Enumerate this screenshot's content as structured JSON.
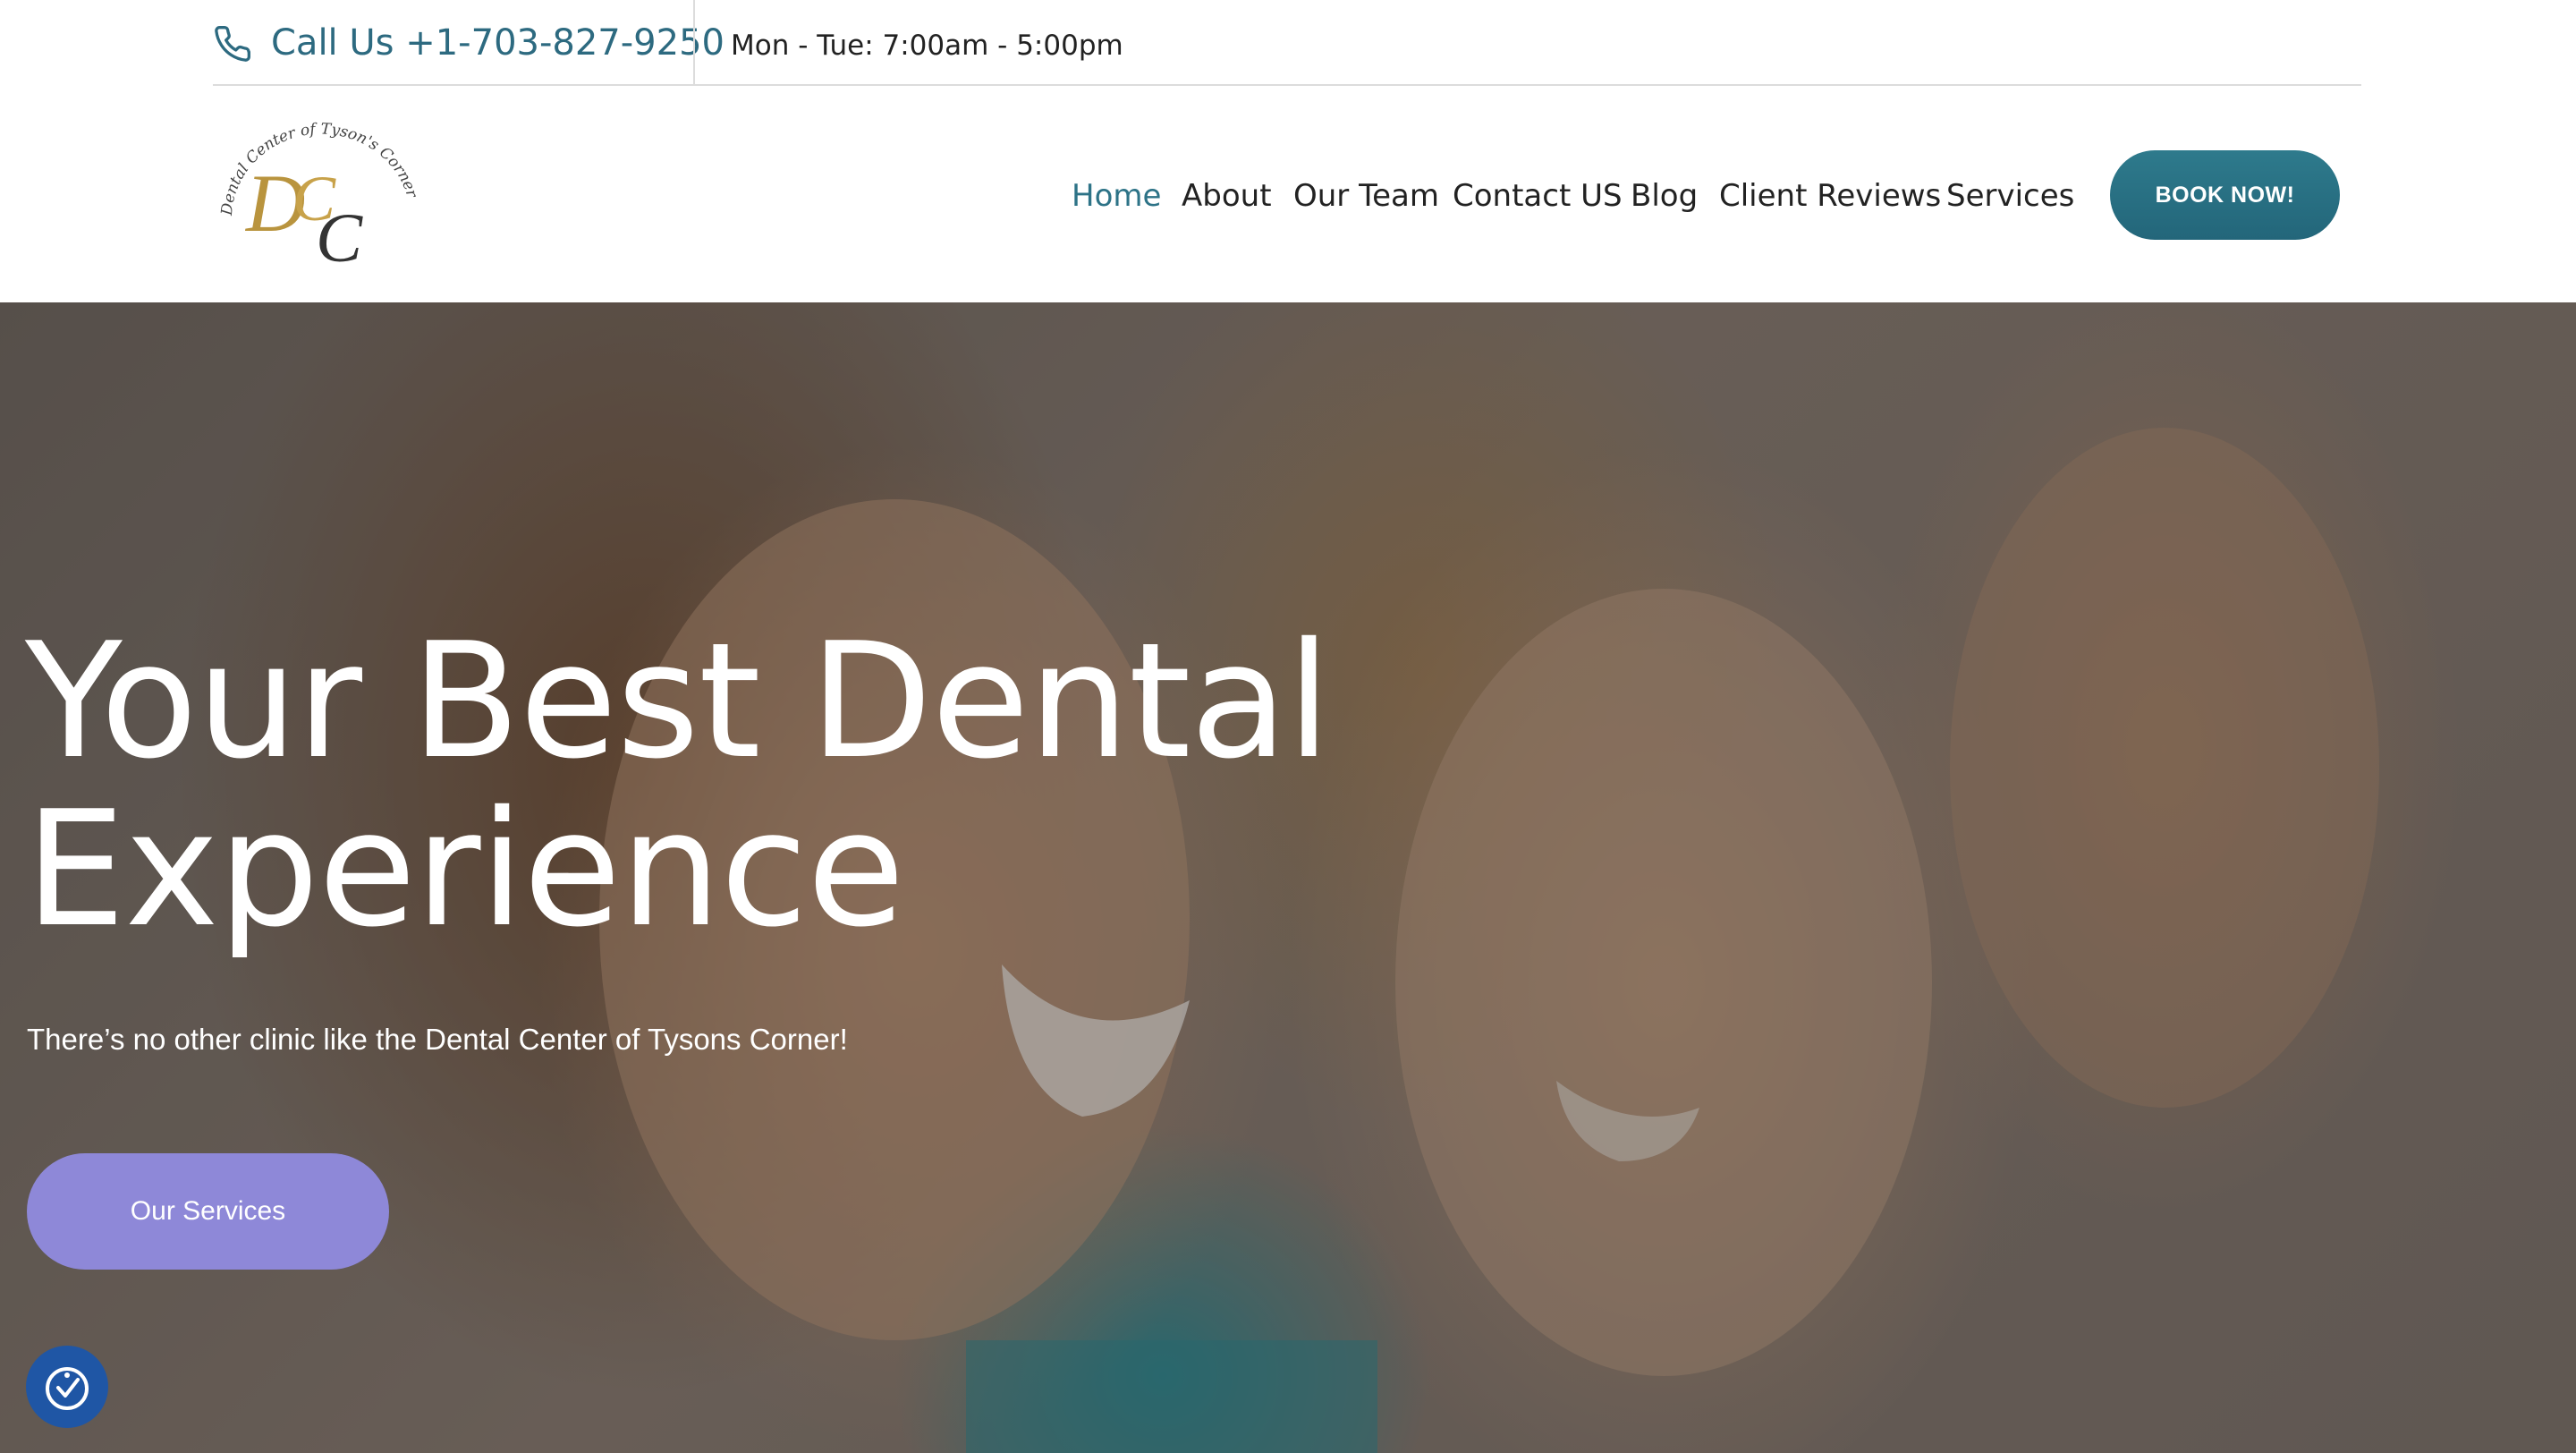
{
  "topbar": {
    "phone_icon": "phone-icon",
    "phone_label": "Call Us +1-703-827-9250",
    "hours": "Mon - Tue: 7:00am - 5:00pm"
  },
  "header": {
    "logo_text": "Dental Center of Tyson's Corner",
    "logo_monogram": "DCC",
    "nav": [
      {
        "label": "Home",
        "active": true
      },
      {
        "label": "About"
      },
      {
        "label": "Our Team"
      },
      {
        "label": "Contact US"
      },
      {
        "label": "Blog"
      },
      {
        "label": "Client Reviews"
      },
      {
        "label": "Services"
      }
    ],
    "cta": "BOOK NOW!"
  },
  "hero": {
    "title_line1": "Your Best Dental",
    "title_line2": "Experience",
    "subtitle": "There’s no other clinic like the Dental Center of Tysons Corner!",
    "button": "Our Services"
  },
  "accessibility": {
    "icon": "accessibility-icon"
  },
  "colors": {
    "accent": "#2d7387",
    "cta_button": "#26697d",
    "services_button": "#8e88d8",
    "accessibility_button": "#1f56a5"
  }
}
